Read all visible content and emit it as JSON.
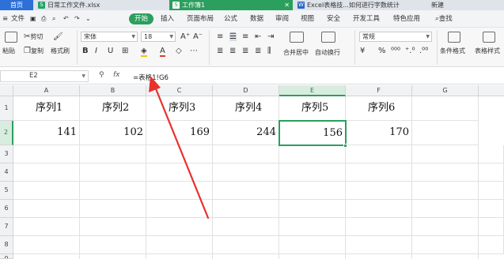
{
  "tabs": {
    "home": "首页",
    "doc1": "日常工作文件.xlsx",
    "doc2": "工作簿1",
    "doc3": "Excel表格技...如何进行字数统计",
    "new": "新建"
  },
  "menu": {
    "file": "文件",
    "start": "开始",
    "insert": "插入",
    "layout": "页面布局",
    "formula": "公式",
    "data": "数据",
    "review": "审阅",
    "view": "视图",
    "security": "安全",
    "dev": "开发工具",
    "special": "特色应用",
    "search": "查找"
  },
  "ribbon": {
    "paste": "粘贴",
    "cut": "剪切",
    "copy": "复制",
    "format_painter": "格式刷",
    "font": "宋体",
    "font_size": "18",
    "merge": "合并居中",
    "wrap": "自动换行",
    "number_format": "常规",
    "cond_format": "条件格式",
    "table_style": "表格样式"
  },
  "formula_bar": {
    "cell_ref": "E2",
    "formula": "=表格1!G6"
  },
  "sheet": {
    "columns": [
      "A",
      "B",
      "C",
      "D",
      "E",
      "F",
      "G"
    ],
    "rows": [
      "1",
      "2",
      "3",
      "4",
      "5",
      "6",
      "7",
      "8",
      "9"
    ],
    "headers": [
      "序列1",
      "序列2",
      "序列3",
      "序列4",
      "序列5",
      "序列6"
    ],
    "values": [
      "141",
      "102",
      "169",
      "244",
      "156",
      "170"
    ],
    "active_column": "E",
    "active_row": "2"
  },
  "colors": {
    "accent": "#2b9f5d",
    "home_tab": "#2e6fd8",
    "annotation_arrow": "#e8322d"
  }
}
